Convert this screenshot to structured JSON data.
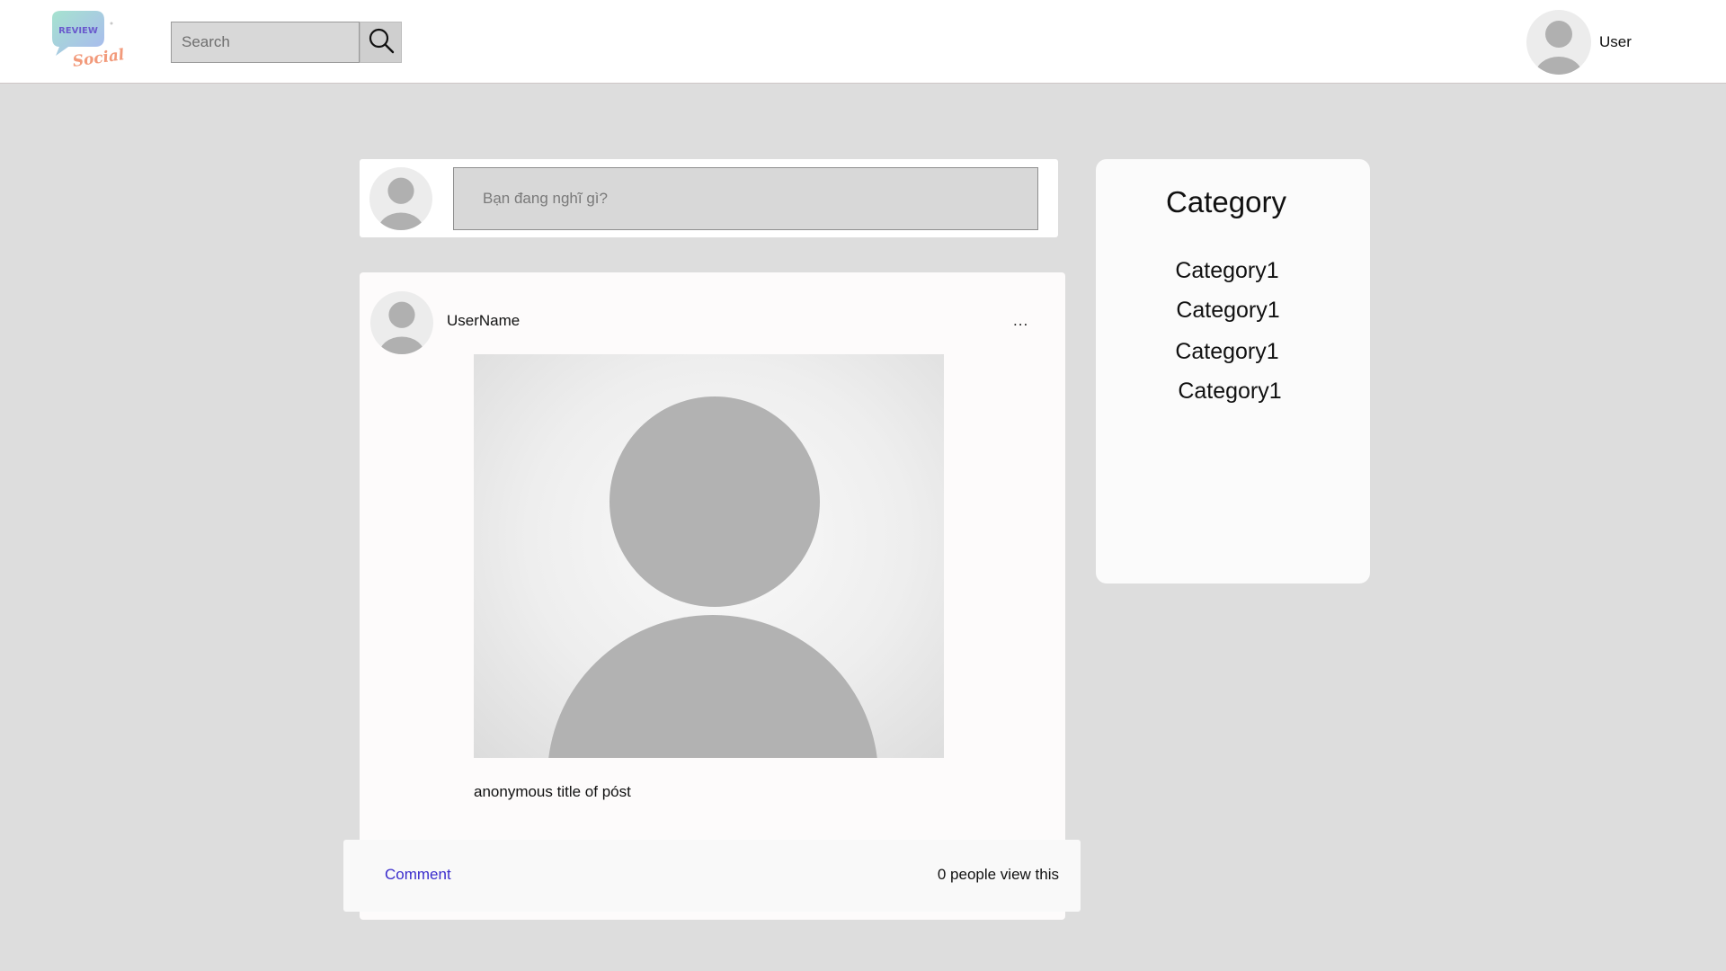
{
  "header": {
    "logo_text": "REVIEW Social",
    "search": {
      "placeholder": "Search",
      "value": ""
    },
    "search_icon": "search-icon",
    "user_name": "User"
  },
  "composer": {
    "placeholder": "Bạn đang nghĩ gì?"
  },
  "post": {
    "username": "UserName",
    "menu_label": "...",
    "title": "anonymous title of póst",
    "comment_label": "Comment",
    "views_text": "0 people view this"
  },
  "categories": {
    "title": "Category",
    "items": [
      "Category1",
      "Category1",
      "Category1",
      "Category1"
    ]
  },
  "colors": {
    "page_background": "#dddddd",
    "link": "#3a2ccc",
    "logo_bubble": "#9ed9d4",
    "logo_text": "#6a5acd",
    "logo_script": "#f29a7b"
  }
}
